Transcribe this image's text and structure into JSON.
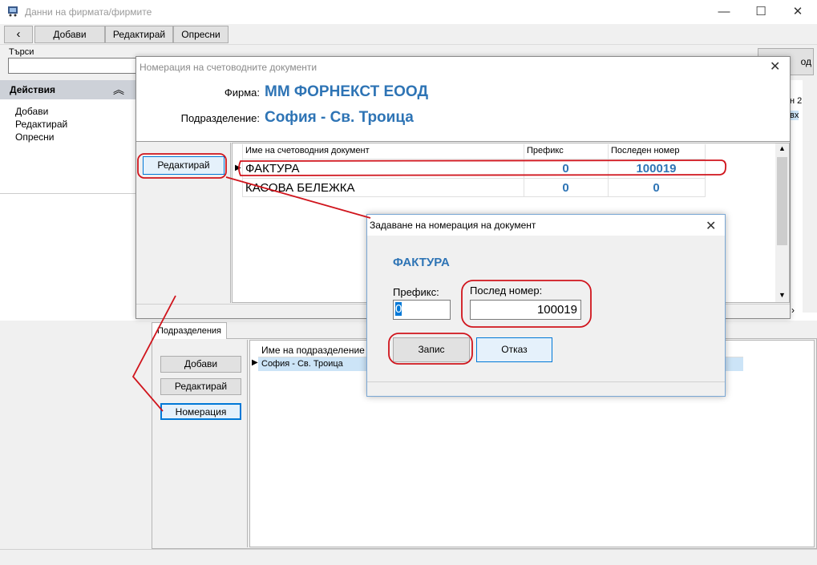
{
  "window": {
    "title": "Данни на фирмата/фирмите",
    "minimize": "—",
    "maximize": "☐",
    "close": "✕"
  },
  "toolbar": {
    "back": "‹",
    "add": "Добави",
    "edit": "Редактирай",
    "refresh": "Опресни"
  },
  "search": {
    "label": "Търси",
    "value": "",
    "button_fragment": "од"
  },
  "actions": {
    "title": "Действия",
    "collapse": "︽",
    "items": [
      "Добави",
      "Редактирай",
      "Опресни"
    ]
  },
  "behind": {
    "text1": "н 2",
    "text2": "вх"
  },
  "subdivisions": {
    "tab": "Подразделения",
    "buttons": {
      "add": "Добави",
      "edit": "Редактирай",
      "numbering": "Номерация"
    },
    "column": "Име на подразделение",
    "rows": [
      "София - Св. Троица"
    ]
  },
  "numbering_dialog": {
    "title": "Номерация на счетоводните документи",
    "close": "✕",
    "company_label": "Фирма:",
    "company": "ММ ФОРНЕКСТ ЕООД",
    "subdivision_label": "Подразделение:",
    "subdivision": "София - Св. Троица",
    "edit_button": "Редактирай",
    "columns": {
      "name": "Име на счетоводния документ",
      "prefix": "Префикс",
      "last": "Последен номер"
    },
    "rows": [
      {
        "name": "ФАКТУРА",
        "prefix": "0",
        "last": "100019"
      },
      {
        "name": "КАСОВА БЕЛЕЖКА",
        "prefix": "0",
        "last": "0"
      }
    ]
  },
  "edit_dialog": {
    "title": "Задаване на номерация на документ",
    "close": "✕",
    "document": "ФАКТУРА",
    "prefix_label": "Префикс:",
    "prefix_value": "0",
    "last_label": "Послед номер:",
    "last_value": "100019",
    "save": "Запис",
    "cancel": "Отказ"
  },
  "colors": {
    "accent_blue": "#2e74b5",
    "annotation_red": "#d0141c",
    "selection_blue": "#cce4f7"
  }
}
